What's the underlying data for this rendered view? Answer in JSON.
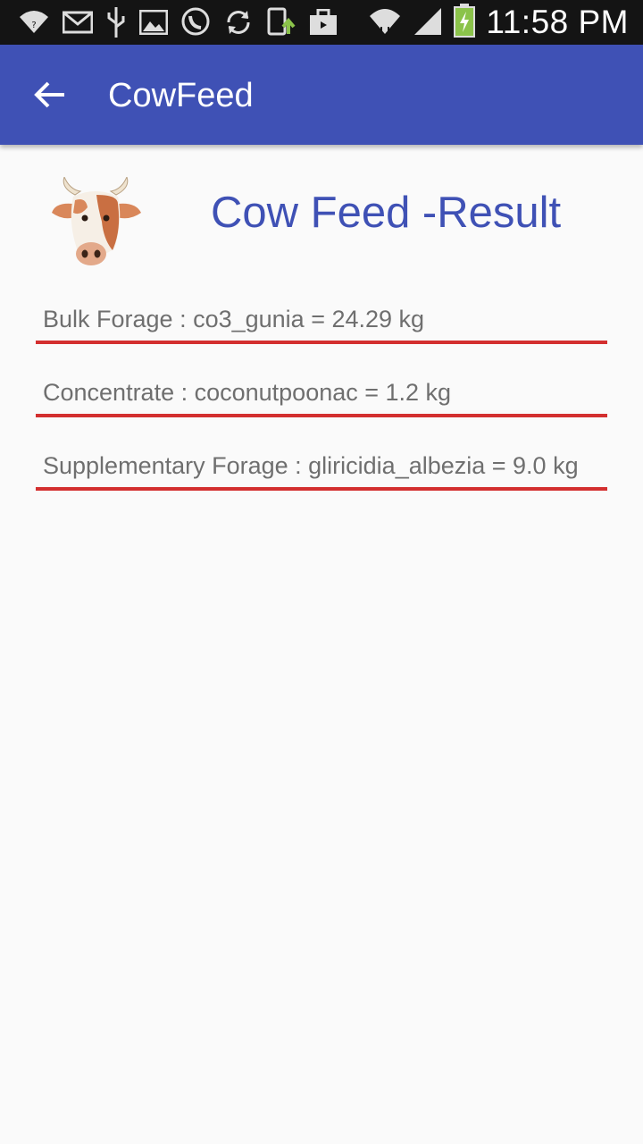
{
  "status_bar": {
    "icons": [
      "wifi-icon",
      "mail-icon",
      "usb-icon",
      "image-icon",
      "viber-icon",
      "sync-icon",
      "download-icon",
      "briefcase-icon"
    ],
    "right_icons": [
      "wifi-signal-icon",
      "cell-signal-icon",
      "battery-charging-icon"
    ],
    "time": "11:58 PM",
    "battery_color": "#8bc34a"
  },
  "app_bar": {
    "title": "CowFeed",
    "back_icon": "arrow-back-icon",
    "background_color": "#3f51b5"
  },
  "header": {
    "logo_icon": "cow-head-icon",
    "title": "Cow Feed -Result",
    "title_color": "#3f51b5"
  },
  "results": [
    {
      "text": "Bulk Forage : co3_gunia = 24.29 kg"
    },
    {
      "text": "Concentrate : coconutpoonac = 1.2 kg"
    },
    {
      "text": "Supplementary Forage : gliricidia_albezia = 9.0 kg"
    }
  ],
  "colors": {
    "underline": "#d32f2f",
    "field_text": "#6f6f6f"
  }
}
